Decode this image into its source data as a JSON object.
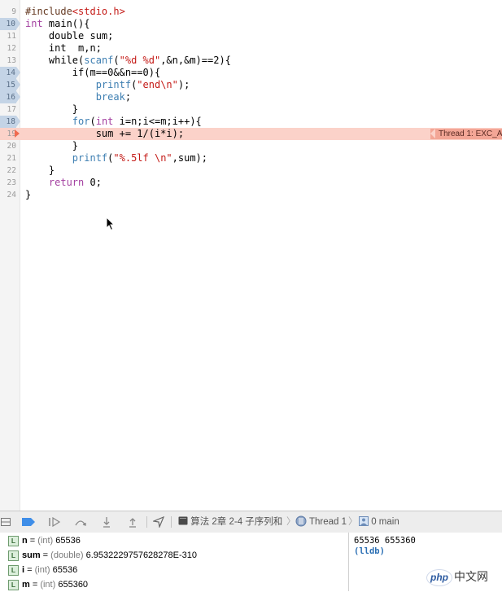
{
  "editor": {
    "lines": [
      {
        "n": "9",
        "bp": false,
        "tokens": [
          {
            "t": "#include",
            "c": "pp"
          },
          {
            "t": "<stdio.h>",
            "c": "inc"
          }
        ]
      },
      {
        "n": "10",
        "bp": true,
        "tokens": [
          {
            "t": "int",
            "c": "kw"
          },
          {
            "t": " main(){",
            "c": ""
          }
        ]
      },
      {
        "n": "11",
        "bp": false,
        "tokens": [
          {
            "t": "    double sum;",
            "c": ""
          }
        ]
      },
      {
        "n": "12",
        "bp": false,
        "tokens": [
          {
            "t": "    int  m,n;",
            "c": ""
          }
        ]
      },
      {
        "n": "13",
        "bp": false,
        "tokens": [
          {
            "t": "    while",
            "c": ""
          },
          {
            "t": "(",
            "c": ""
          },
          {
            "t": "scanf",
            "c": "fn"
          },
          {
            "t": "(",
            "c": ""
          },
          {
            "t": "\"%d %d\"",
            "c": "str"
          },
          {
            "t": ",&n,&m)==2){",
            "c": ""
          }
        ]
      },
      {
        "n": "14",
        "bp": true,
        "tokens": [
          {
            "t": "        if",
            "c": ""
          },
          {
            "t": "(m==0&&n==0){",
            "c": ""
          }
        ]
      },
      {
        "n": "15",
        "bp": true,
        "tokens": [
          {
            "t": "            ",
            "c": ""
          },
          {
            "t": "printf",
            "c": "fn"
          },
          {
            "t": "(",
            "c": ""
          },
          {
            "t": "\"end\\n\"",
            "c": "str"
          },
          {
            "t": ");",
            "c": ""
          }
        ]
      },
      {
        "n": "16",
        "bp": true,
        "tokens": [
          {
            "t": "            ",
            "c": ""
          },
          {
            "t": "break",
            "c": "fn"
          },
          {
            "t": ";",
            "c": ""
          }
        ]
      },
      {
        "n": "17",
        "bp": false,
        "tokens": [
          {
            "t": "        }",
            "c": ""
          }
        ]
      },
      {
        "n": "18",
        "bp": true,
        "tokens": [
          {
            "t": "        ",
            "c": ""
          },
          {
            "t": "for",
            "c": "fn"
          },
          {
            "t": "(",
            "c": ""
          },
          {
            "t": "int",
            "c": "kw"
          },
          {
            "t": " i=n;i<=m;i++){",
            "c": ""
          }
        ]
      },
      {
        "n": "19",
        "bp": false,
        "error": true,
        "tokens": [
          {
            "t": "            sum += 1/(i*i);",
            "c": ""
          }
        ]
      },
      {
        "n": "20",
        "bp": false,
        "tokens": [
          {
            "t": "        }",
            "c": ""
          }
        ]
      },
      {
        "n": "21",
        "bp": false,
        "tokens": [
          {
            "t": "        ",
            "c": ""
          },
          {
            "t": "printf",
            "c": "fn"
          },
          {
            "t": "(",
            "c": ""
          },
          {
            "t": "\"%.5lf \\n\"",
            "c": "str"
          },
          {
            "t": ",sum);",
            "c": ""
          }
        ]
      },
      {
        "n": "22",
        "bp": false,
        "tokens": [
          {
            "t": "    }",
            "c": ""
          }
        ]
      },
      {
        "n": "23",
        "bp": false,
        "tokens": [
          {
            "t": "    ",
            "c": ""
          },
          {
            "t": "return",
            "c": "kw"
          },
          {
            "t": " 0;",
            "c": ""
          }
        ]
      },
      {
        "n": "24",
        "bp": false,
        "tokens": [
          {
            "t": "}",
            "c": ""
          }
        ]
      }
    ],
    "error_badge": "Thread 1: EXC_A"
  },
  "debugbar": {
    "icons": [
      "hide-panel-icon",
      "breakpoints-toggle-icon",
      "continue-icon",
      "step-over-icon",
      "step-into-icon",
      "step-out-icon",
      "location-icon"
    ],
    "file_label": "算法 2章 2-4 子序列和",
    "thread_label": "Thread 1",
    "frame_label": "0 main"
  },
  "variables": [
    {
      "name": "n",
      "type": "(int)",
      "value": "65536"
    },
    {
      "name": "sum",
      "type": "(double)",
      "value": "6.9532229757628278E-310"
    },
    {
      "name": "i",
      "type": "(int)",
      "value": "65536"
    },
    {
      "name": "m",
      "type": "(int)",
      "value": "655360"
    }
  ],
  "console": {
    "output": "65536 655360",
    "prompt": "(lldb)"
  },
  "watermark": {
    "badge": "php",
    "text": "中文网"
  },
  "colors": {
    "error_line": "#fbd2c9",
    "breakpoint": "#c4d4e6",
    "keyword": "#a33fa0",
    "string": "#c41a16",
    "function": "#3e7fb2"
  }
}
